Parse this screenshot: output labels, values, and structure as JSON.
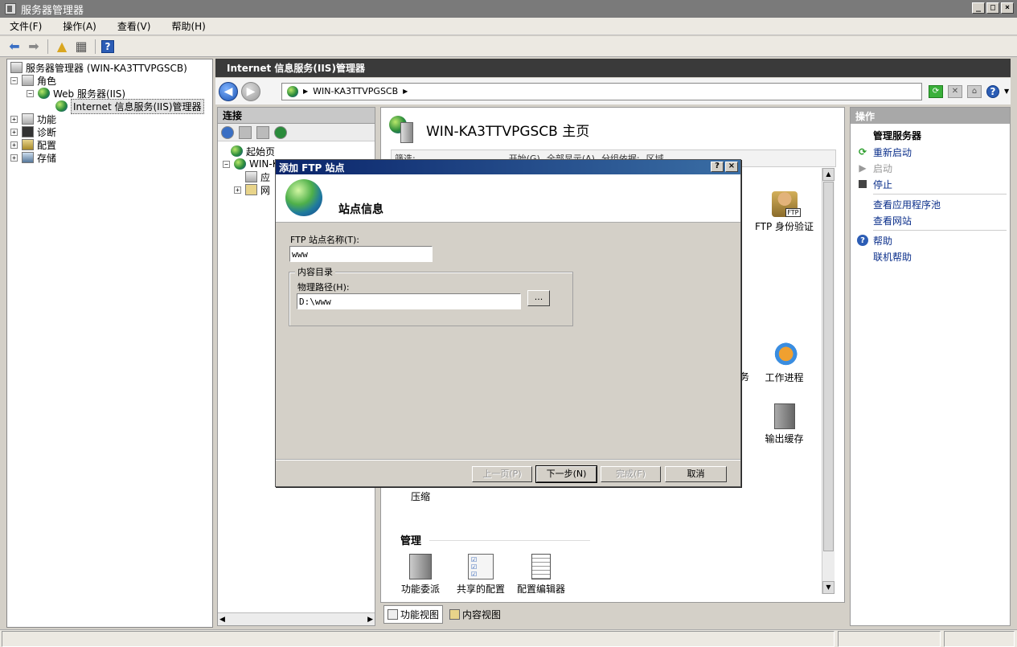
{
  "window": {
    "title": "服务器管理器"
  },
  "menu": [
    "文件(F)",
    "操作(A)",
    "查看(V)",
    "帮助(H)"
  ],
  "left_tree": {
    "root": "服务器管理器 (WIN-KA3TTVPGSCB)",
    "roles": "角色",
    "web_server": "Web 服务器(IIS)",
    "iis_manager": "Internet 信息服务(IIS)管理器",
    "features": "功能",
    "diagnostics": "诊断",
    "config": "配置",
    "storage": "存储"
  },
  "iis": {
    "header": "Internet 信息服务(IIS)管理器",
    "address": "WIN-KA3TTVPGSCB",
    "connections_title": "连接",
    "conn_tree": {
      "start_page": "起始页",
      "server": "WIN-K",
      "app_pools": "应",
      "sites": "网"
    },
    "home_title": "WIN-KA3TTVPGSCB 主页",
    "filter": {
      "label": "筛选:",
      "go": "开始(G)",
      "show_all": "全部显示(A)",
      "group": "分组依据:",
      "group_value": "区域"
    },
    "features": {
      "ftp_auth": "FTP 身份验证",
      "worker": "工作进程",
      "cache": "输出缓存",
      "compression": "压缩",
      "delegation": "功能委派",
      "shared_config": "共享的配置",
      "config_editor": "配置编辑器",
      "hidden_suffix": "务"
    },
    "management_label": "管理",
    "view_tabs": {
      "features": "功能视图",
      "content": "内容视图"
    }
  },
  "actions": {
    "title": "操作",
    "manage_server": "管理服务器",
    "restart": "重新启动",
    "start": "启动",
    "stop": "停止",
    "view_app_pools": "查看应用程序池",
    "view_sites": "查看网站",
    "help": "帮助",
    "online_help": "联机帮助"
  },
  "dialog": {
    "title": "添加 FTP 站点",
    "header": "站点信息",
    "site_name_label": "FTP 站点名称(T):",
    "site_name_value": "www",
    "content_dir_legend": "内容目录",
    "physical_path_label": "物理路径(H):",
    "physical_path_value": "D:\\www",
    "browse": "...",
    "prev": "上一页(P)",
    "next": "下一步(N)",
    "finish": "完成(F)",
    "cancel": "取消"
  }
}
